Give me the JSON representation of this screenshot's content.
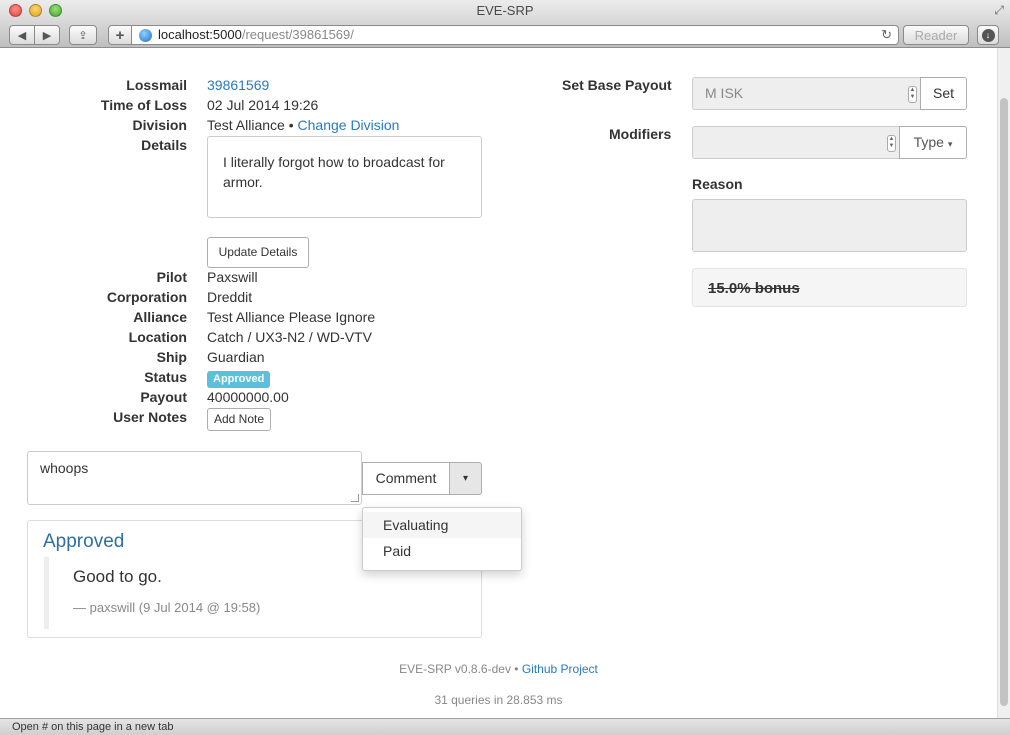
{
  "window": {
    "title": "EVE-SRP"
  },
  "toolbar": {
    "url_host": "localhost:5000",
    "url_path": "/request/39861569/",
    "reader_label": "Reader"
  },
  "details": {
    "lossmail_label": "Lossmail",
    "lossmail_value": "39861569",
    "time_label": "Time of Loss",
    "time_value": "02 Jul 2014 19:26",
    "division_label": "Division",
    "division_value": "Test Alliance",
    "division_sep": "•",
    "change_division": "Change Division",
    "details_label": "Details",
    "details_text": "I literally forgot how to broadcast for armor.",
    "update_button": "Update Details",
    "pilot_label": "Pilot",
    "pilot_value": "Paxswill",
    "corp_label": "Corporation",
    "corp_value": "Dreddit",
    "alliance_label": "Alliance",
    "alliance_value": "Test Alliance Please Ignore",
    "location_label": "Location",
    "location_value": "Catch / UX3-N2 / WD-VTV",
    "ship_label": "Ship",
    "ship_value": "Guardian",
    "status_label": "Status",
    "status_value": "Approved",
    "payout_label": "Payout",
    "payout_value": "40000000.00",
    "notes_label": "User Notes",
    "add_note_button": "Add Note"
  },
  "comment": {
    "text": "whoops",
    "button": "Comment",
    "caret": "▾",
    "menu": [
      "Evaluating",
      "Paid"
    ]
  },
  "action_panel": {
    "title": "Approved",
    "quote": "Good to go.",
    "author": "— paxswill (9 Jul 2014 @ 19:58)"
  },
  "right": {
    "base_payout_label": "Set Base Payout",
    "base_payout_placeholder": "M ISK",
    "set_button": "Set",
    "modifiers_label": "Modifiers",
    "type_button": "Type",
    "reason_label": "Reason",
    "bonus_text": "15.0% bonus"
  },
  "footer": {
    "version": "EVE-SRP v0.8.6-dev",
    "sep": "•",
    "github": "Github Project",
    "queries": "31 queries in 28.853 ms"
  },
  "statusbar": {
    "text": "Open # on this page in a new tab"
  },
  "colors": {
    "link": "#2a7bbd",
    "badge": "#5bc0de",
    "panel_title": "#2e6fa1"
  }
}
